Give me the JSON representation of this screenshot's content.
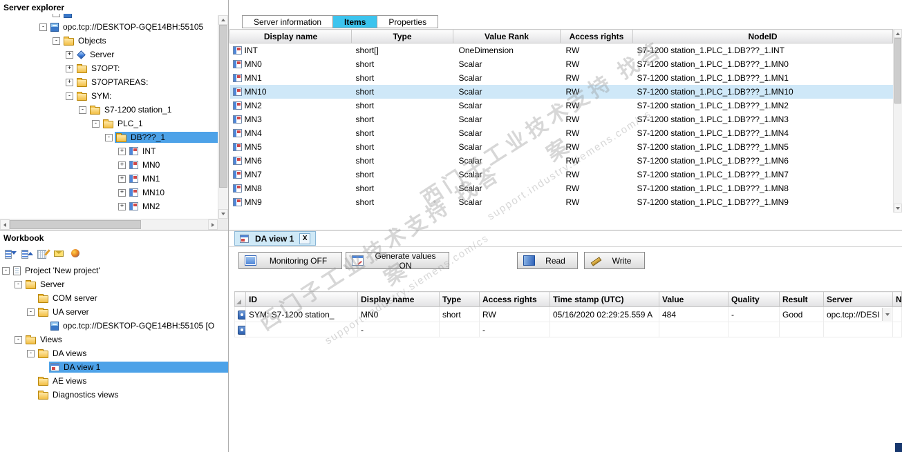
{
  "colors": {
    "selection": "#4da2e8",
    "row_highlight": "#cfe8f8",
    "tab_active": "#3cc4ee",
    "da_tab_bg": "#cfe9f7",
    "header_top": "#fdfdfd",
    "header_bottom": "#e2e2e4"
  },
  "watermark": {
    "line1": "西门子工业技术支持 找答案",
    "line2": "support.industry.siemens.com/cs"
  },
  "server_explorer": {
    "title": "Server explorer",
    "tree": [
      {
        "level": 3,
        "box": "-",
        "icon": "server",
        "label": "",
        "partial": true
      },
      {
        "level": 2,
        "box": "-",
        "icon": "server",
        "label": "opc.tcp://DESKTOP-GQE14BH:55105"
      },
      {
        "level": 3,
        "box": "-",
        "icon": "folder",
        "label": "Objects"
      },
      {
        "level": 4,
        "box": "+",
        "icon": "object",
        "label": "Server"
      },
      {
        "level": 4,
        "box": "+",
        "icon": "folder",
        "label": "S7OPT:"
      },
      {
        "level": 4,
        "box": "+",
        "icon": "folder",
        "label": "S7OPTAREAS:"
      },
      {
        "level": 4,
        "box": "-",
        "icon": "folder",
        "label": "SYM:"
      },
      {
        "level": 5,
        "box": "-",
        "icon": "folder",
        "label": "S7-1200 station_1"
      },
      {
        "level": 6,
        "box": "-",
        "icon": "folder",
        "label": "PLC_1"
      },
      {
        "level": 7,
        "box": "-",
        "icon": "folder",
        "label": "DB???_1",
        "selected": true
      },
      {
        "level": 8,
        "box": "+",
        "icon": "tag",
        "label": "INT"
      },
      {
        "level": 8,
        "box": "+",
        "icon": "tag",
        "label": "MN0"
      },
      {
        "level": 8,
        "box": "+",
        "icon": "tag",
        "label": "MN1"
      },
      {
        "level": 8,
        "box": "+",
        "icon": "tag",
        "label": "MN10"
      },
      {
        "level": 8,
        "box": "+",
        "icon": "tag",
        "label": "MN2"
      }
    ]
  },
  "items_panel": {
    "tabs": [
      {
        "label": "Server information",
        "active": false
      },
      {
        "label": "Items",
        "active": true
      },
      {
        "label": "Properties",
        "active": false
      }
    ],
    "columns": [
      "Display name",
      "Type",
      "Value Rank",
      "Access rights",
      "NodeID"
    ],
    "rows": [
      {
        "display": "INT",
        "type": "short[]",
        "rank": "OneDimension",
        "access": "RW",
        "node": "S7-1200 station_1.PLC_1.DB???_1.INT"
      },
      {
        "display": "MN0",
        "type": "short",
        "rank": "Scalar",
        "access": "RW",
        "node": "S7-1200 station_1.PLC_1.DB???_1.MN0"
      },
      {
        "display": "MN1",
        "type": "short",
        "rank": "Scalar",
        "access": "RW",
        "node": "S7-1200 station_1.PLC_1.DB???_1.MN1"
      },
      {
        "display": "MN10",
        "type": "short",
        "rank": "Scalar",
        "access": "RW",
        "node": "S7-1200 station_1.PLC_1.DB???_1.MN10",
        "selected": true
      },
      {
        "display": "MN2",
        "type": "short",
        "rank": "Scalar",
        "access": "RW",
        "node": "S7-1200 station_1.PLC_1.DB???_1.MN2"
      },
      {
        "display": "MN3",
        "type": "short",
        "rank": "Scalar",
        "access": "RW",
        "node": "S7-1200 station_1.PLC_1.DB???_1.MN3"
      },
      {
        "display": "MN4",
        "type": "short",
        "rank": "Scalar",
        "access": "RW",
        "node": "S7-1200 station_1.PLC_1.DB???_1.MN4"
      },
      {
        "display": "MN5",
        "type": "short",
        "rank": "Scalar",
        "access": "RW",
        "node": "S7-1200 station_1.PLC_1.DB???_1.MN5"
      },
      {
        "display": "MN6",
        "type": "short",
        "rank": "Scalar",
        "access": "RW",
        "node": "S7-1200 station_1.PLC_1.DB???_1.MN6"
      },
      {
        "display": "MN7",
        "type": "short",
        "rank": "Scalar",
        "access": "RW",
        "node": "S7-1200 station_1.PLC_1.DB???_1.MN7"
      },
      {
        "display": "MN8",
        "type": "short",
        "rank": "Scalar",
        "access": "RW",
        "node": "S7-1200 station_1.PLC_1.DB???_1.MN8"
      },
      {
        "display": "MN9",
        "type": "short",
        "rank": "Scalar",
        "access": "RW",
        "node": "S7-1200 station_1.PLC_1.DB???_1.MN9"
      }
    ]
  },
  "workbook": {
    "title": "Workbook",
    "toolbar": [
      "insert-list-icon",
      "remove-list-icon",
      "edit-list-icon",
      "mail-icon",
      "connect-icon"
    ],
    "tree": [
      {
        "level": 0,
        "box": "-",
        "icon": "project",
        "label": "Project 'New project'"
      },
      {
        "level": 1,
        "box": "-",
        "icon": "folder",
        "label": "Server"
      },
      {
        "level": 2,
        "icon": "folder",
        "label": "COM server"
      },
      {
        "level": 2,
        "box": "-",
        "icon": "folder",
        "label": "UA server"
      },
      {
        "level": 3,
        "icon": "server",
        "label": "opc.tcp://DESKTOP-GQE14BH:55105 [O"
      },
      {
        "level": 1,
        "box": "-",
        "icon": "folder",
        "label": "Views"
      },
      {
        "level": 2,
        "box": "-",
        "icon": "folder",
        "label": "DA views"
      },
      {
        "level": 3,
        "icon": "view",
        "label": "DA view 1",
        "selected": true
      },
      {
        "level": 2,
        "icon": "folder",
        "label": "AE views"
      },
      {
        "level": 2,
        "icon": "folder",
        "label": "Diagnostics views"
      }
    ]
  },
  "da_view": {
    "tab_label": "DA view 1",
    "close_label": "X",
    "buttons": {
      "monitoring": "Monitoring OFF",
      "generate": "Generate values ON",
      "read": "Read",
      "write": "Write"
    },
    "columns": [
      "ID",
      "Display name",
      "Type",
      "Access rights",
      "Time stamp (UTC)",
      "Value",
      "Quality",
      "Result",
      "Server",
      "N"
    ],
    "rows": [
      {
        "id": "SYM: S7-1200 station_",
        "display": "MN0",
        "type": "short",
        "access": "RW",
        "timestamp": "05/16/2020 02:29:25.559 A",
        "value": "484",
        "quality": "-",
        "result": "Good",
        "server": "opc.tcp://DESI",
        "server_dropdown": true
      },
      {
        "id": "",
        "display": "-",
        "type": "",
        "access": "-",
        "timestamp": "",
        "value": "",
        "quality": "",
        "result": "",
        "server": ""
      }
    ]
  }
}
